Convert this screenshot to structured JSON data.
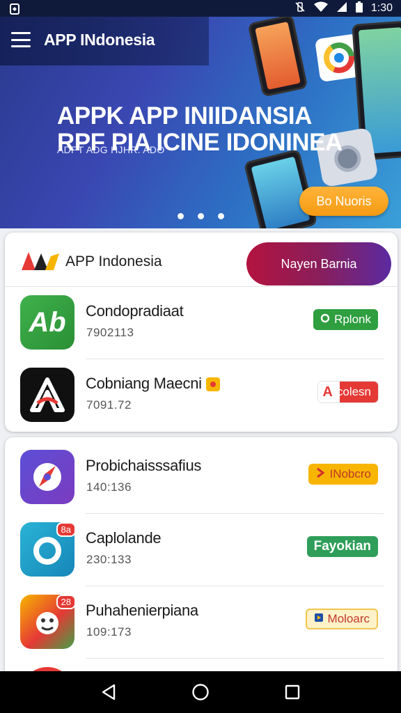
{
  "status_bar": {
    "time": "1:30"
  },
  "header": {
    "app_title": "APP INdonesia"
  },
  "hero": {
    "headline_line1": "APPK APP INIIDANSIA",
    "headline_line2": "RPF PIA ICINE IDONINEA",
    "subtitle": "ADPT ADG HJHR. ADO",
    "cta_label": "Bo Nuoris",
    "slide_count": 3
  },
  "card1": {
    "brand_name": "APP Indonesia",
    "header_button_label": "Nayen Barnia",
    "apps": [
      {
        "name": "Condopradiaat",
        "number": "7902113",
        "action_label": "Rplonk",
        "action_icon": "circle-outline-icon",
        "icon": "ab-app-icon"
      },
      {
        "name": "Cobniang Maecni",
        "number": "7091.72",
        "action_label": "colesn",
        "action_icon": "letter-a-icon",
        "icon": "a-logo-app-icon"
      }
    ]
  },
  "card2": {
    "apps": [
      {
        "name": "Probichaisssafius",
        "number": "140:136",
        "action_label": "INobcro",
        "action_icon": "chevron-right-icon",
        "icon": "compass-app-icon"
      },
      {
        "name": "Caplolande",
        "number": "230:133",
        "action_label": "Fayokian",
        "action_icon": "",
        "icon": "ring-app-icon",
        "badge": "8a"
      },
      {
        "name": "Puhahenierpiana",
        "number": "109:173",
        "action_label": "Moloarc",
        "action_icon": "media-icon",
        "icon": "map-clock-app-icon",
        "badge": "28"
      }
    ]
  },
  "colors": {
    "hero_gradient_start": "#2a3a8e",
    "hero_gradient_end": "#3aa0d8",
    "cta_orange": "#f59a12",
    "header_button_start": "#b3133f",
    "header_button_end": "#5b2aa0",
    "green": "#2e9e3f",
    "red": "#e53935",
    "yellow": "#f7b500"
  }
}
